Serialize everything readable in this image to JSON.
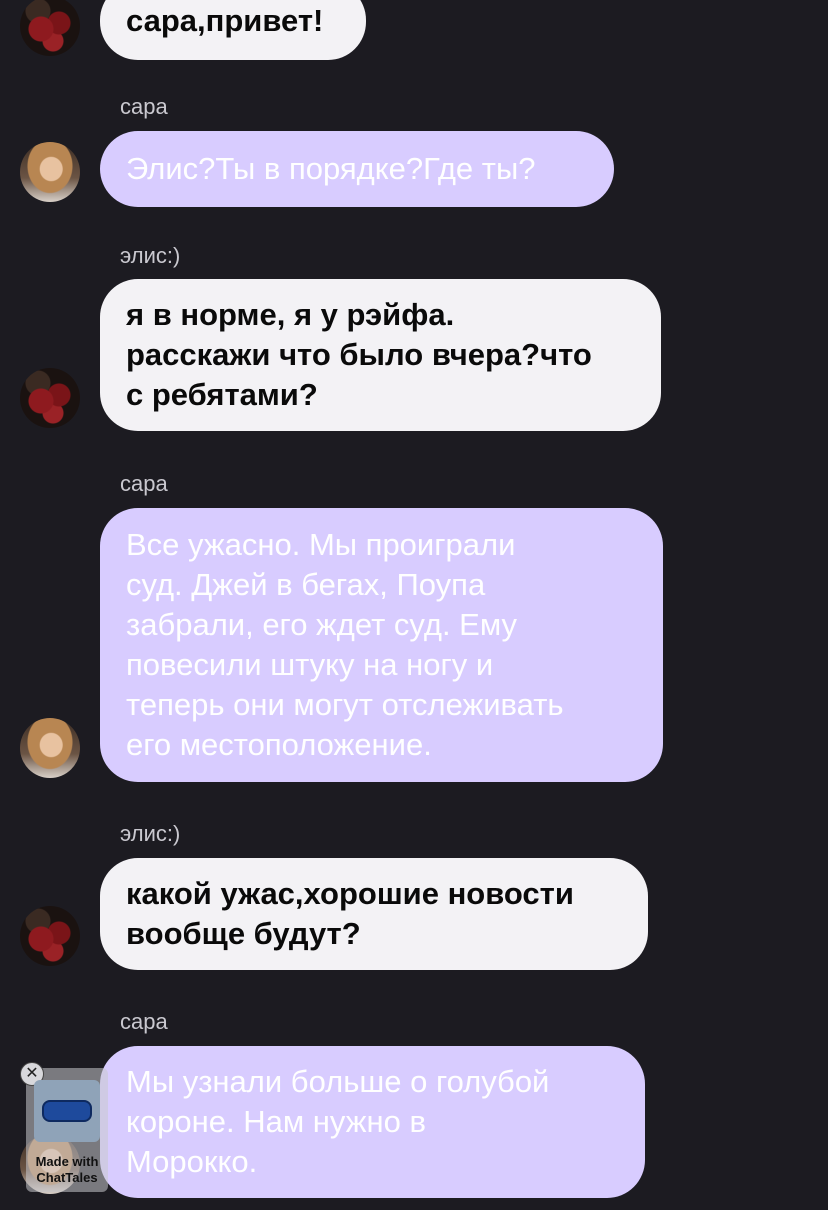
{
  "messages": [
    {
      "sender": "",
      "text": "сара,привет!",
      "style": "white"
    },
    {
      "sender": "сара",
      "text": "Элис?Ты в порядке?Где ты?",
      "style": "purple"
    },
    {
      "sender": "элис:)",
      "text": "я в норме, я у рэйфа.\nрасскажи что было вчера?что\nс ребятами?",
      "style": "white"
    },
    {
      "sender": "сара",
      "text": "Все ужасно. Мы проиграли\nсуд. Джей в бегах, Поупа\nзабрали, его ждет суд. Ему\nповесили штуку на ногу и\nтеперь они могут отслеживать\nего местоположение.",
      "style": "purple"
    },
    {
      "sender": "элис:)",
      "text": "какой ужас,хорошие новости\nвообще будут?",
      "style": "white"
    },
    {
      "sender": "сара",
      "text": "Мы узнали больше о голубой\nкороне. Нам нужно в\nМорокко.",
      "style": "purple"
    }
  ],
  "watermark": {
    "line1": "Made with",
    "line2": "ChatTales",
    "close_icon": "close-icon"
  },
  "colors": {
    "background": "#1c1b21",
    "bubble_white": "#f3f2f5",
    "bubble_purple": "#d8ccff",
    "sender_name": "#c9c8cf"
  }
}
